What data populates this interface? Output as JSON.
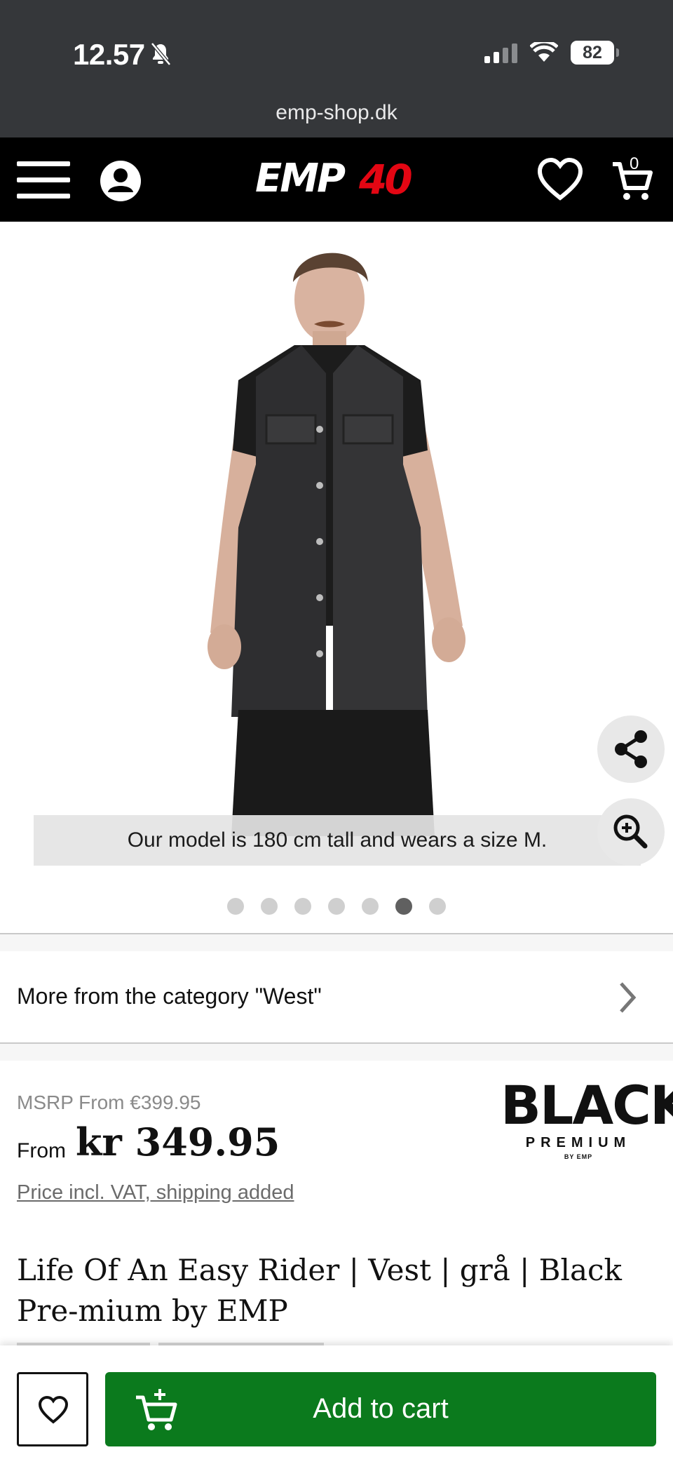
{
  "status_bar": {
    "time": "12.57",
    "battery": "82",
    "url": "emp-shop.dk"
  },
  "header": {
    "logo_text": "EMP",
    "logo_number": "40",
    "cart_count": "0"
  },
  "gallery": {
    "caption": "Our model is 180 cm tall and wears a size M.",
    "dots_total": 7,
    "active_dot": 6
  },
  "category": {
    "label": "More from the category \"West\""
  },
  "pricing": {
    "msrp": "MSRP From €399.95",
    "from_label": "From",
    "price": "kr 349.95",
    "vat_note": "Price incl. VAT, shipping added"
  },
  "brand": {
    "name": "BLACK",
    "line": "PREMIUM",
    "by": "BY EMP"
  },
  "product": {
    "title": "Life Of An Easy Rider | Vest | grå | Black Pre-mium by EMP"
  },
  "actions": {
    "add_to_cart": "Add to cart"
  },
  "icons": {
    "menu": "hamburger-menu-icon",
    "account": "account-icon",
    "wishlist": "heart-icon",
    "cart": "cart-icon",
    "share": "share-icon",
    "zoom": "zoom-in-icon",
    "chevron": "chevron-right-icon"
  },
  "colors": {
    "status_bar": "#35373a",
    "header": "#000000",
    "logo_accent": "#e30613",
    "add_to_cart": "#0b7a1d"
  }
}
